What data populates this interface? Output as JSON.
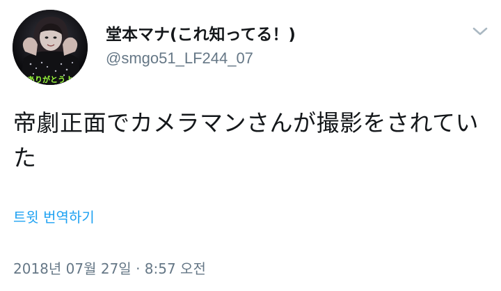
{
  "author": {
    "display_name": "堂本マナ(これ知ってる！)",
    "handle": "@smgo51_LF244_07",
    "avatar_caption": "ありがとうよ"
  },
  "menu": {
    "icon": "chevron-down-icon"
  },
  "tweet": {
    "text": "帝劇正面でカメラマンさんが撮影をされていた",
    "translate_label": "트윗 번역하기",
    "timestamp": "2018년 07월 27일 · 8:57 오전"
  },
  "colors": {
    "link": "#1da1f2",
    "secondary_text": "#657786",
    "primary_text": "#14171a",
    "caption": "#9cff3c"
  }
}
